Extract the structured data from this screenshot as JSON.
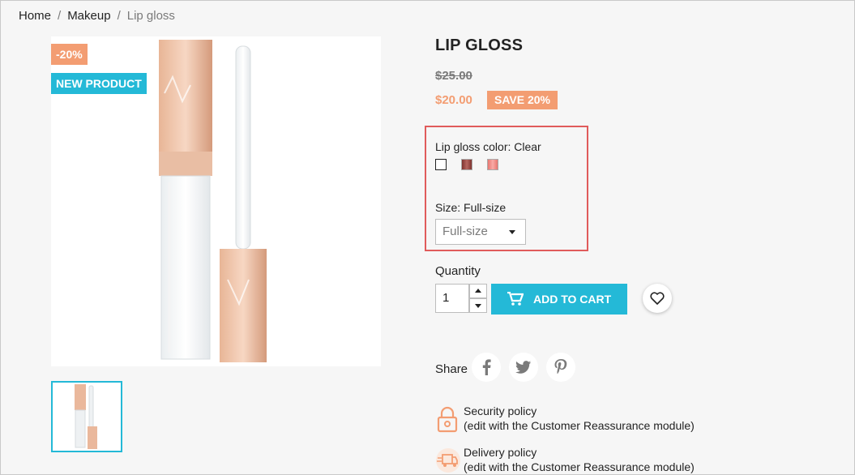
{
  "breadcrumb": {
    "items": [
      "Home",
      "Makeup",
      "Lip gloss"
    ],
    "separator": "/"
  },
  "product": {
    "badges": {
      "discount": "-20%",
      "new": "NEW PRODUCT"
    },
    "title": "LIP GLOSS",
    "regular_price": "$25.00",
    "price": "$20.00",
    "save_badge": "SAVE 20%"
  },
  "variants": {
    "color_label": "Lip gloss color: Clear",
    "color_swatches": [
      {
        "name": "Clear",
        "color": "#ffffff"
      },
      {
        "name": "Brown",
        "color": "#9c4a45"
      },
      {
        "name": "Pink",
        "color": "#f08a87"
      }
    ],
    "size_label": "Size: Full-size",
    "size_selected": "Full-size"
  },
  "quantity": {
    "label": "Quantity",
    "value": "1"
  },
  "add_to_cart": "ADD TO CART",
  "share": {
    "label": "Share"
  },
  "reassurance": [
    {
      "title": "Security policy",
      "subtitle": "(edit with the Customer Reassurance module)",
      "icon": "lock-icon"
    },
    {
      "title": "Delivery policy",
      "subtitle": "(edit with the Customer Reassurance module)",
      "icon": "truck-icon"
    }
  ],
  "colors": {
    "accent": "#24b9d7",
    "discount": "#f39d72",
    "highlight_border": "#e05b5b"
  }
}
